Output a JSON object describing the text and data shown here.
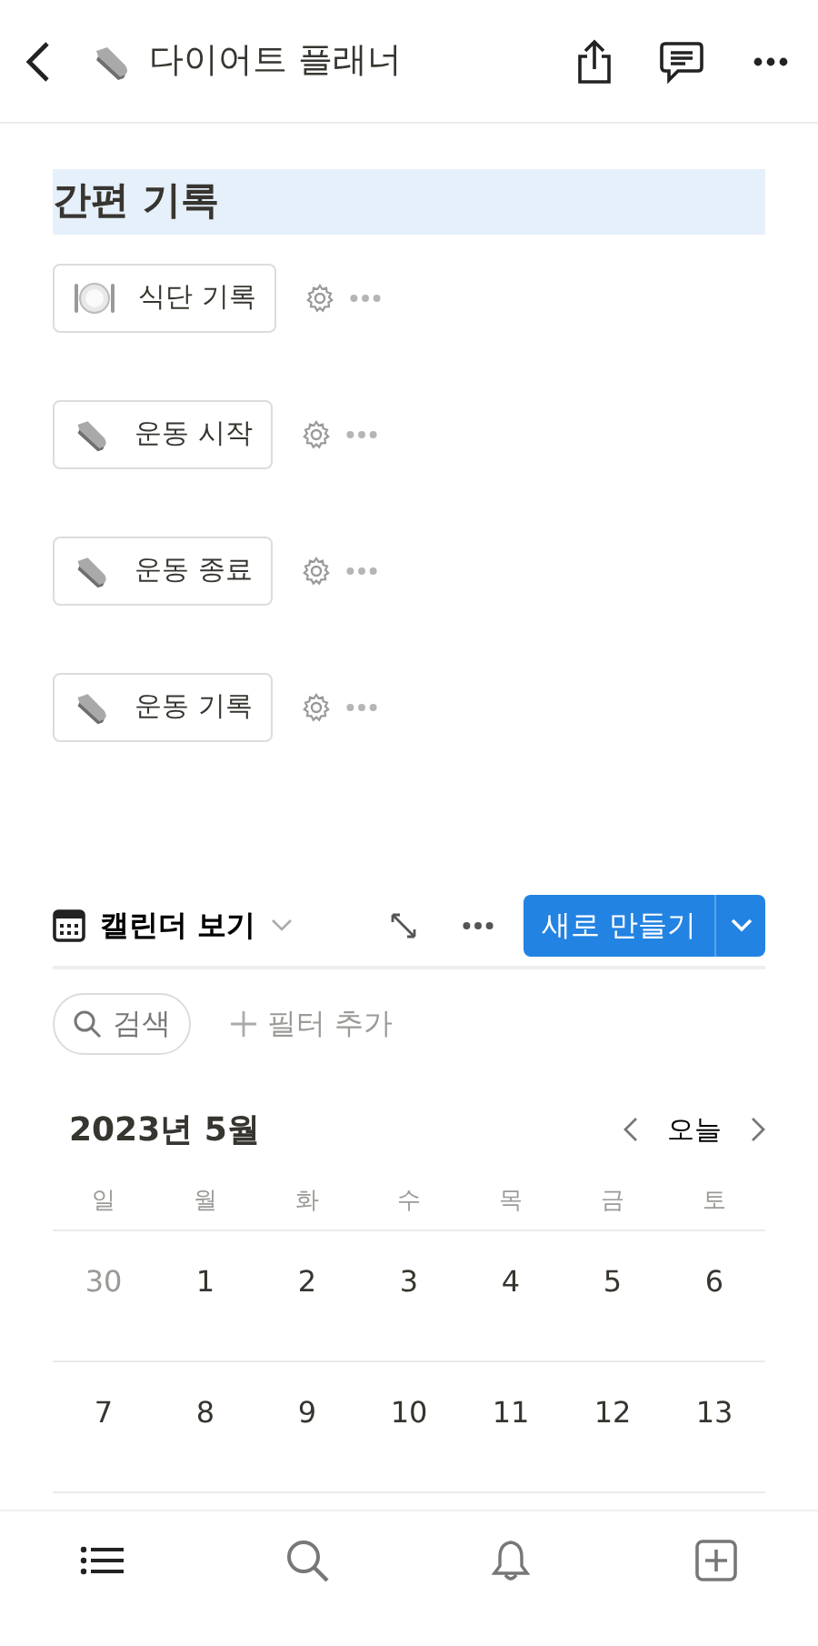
{
  "header": {
    "title": "다이어트 플래너"
  },
  "section": {
    "title": "간편 기록",
    "selected": true
  },
  "quick_buttons": [
    {
      "label": "식단 기록",
      "kind": "meal"
    },
    {
      "label": "운동 시작",
      "kind": "shoe"
    },
    {
      "label": "운동 종료",
      "kind": "shoe"
    },
    {
      "label": "운동 기록",
      "kind": "shoe"
    }
  ],
  "view": {
    "label": "캘린더 보기",
    "new_button": "새로 만들기"
  },
  "search": {
    "label": "검색"
  },
  "filter": {
    "label": "필터 추가"
  },
  "calendar": {
    "month": "2023년 5월",
    "today": "오늘",
    "weekdays": [
      "일",
      "월",
      "화",
      "수",
      "목",
      "금",
      "토"
    ],
    "weeks": [
      [
        {
          "day": "30",
          "muted": true
        },
        {
          "day": "1",
          "muted": false
        },
        {
          "day": "2",
          "muted": false
        },
        {
          "day": "3",
          "muted": false
        },
        {
          "day": "4",
          "muted": false
        },
        {
          "day": "5",
          "muted": false
        },
        {
          "day": "6",
          "muted": false
        }
      ],
      [
        {
          "day": "7",
          "muted": false
        },
        {
          "day": "8",
          "muted": false
        },
        {
          "day": "9",
          "muted": false
        },
        {
          "day": "10",
          "muted": false
        },
        {
          "day": "11",
          "muted": false
        },
        {
          "day": "12",
          "muted": false
        },
        {
          "day": "13",
          "muted": false
        }
      ]
    ]
  },
  "tab_bar": [
    {
      "kind": "list"
    },
    {
      "kind": "search"
    },
    {
      "kind": "bell"
    },
    {
      "kind": "add"
    }
  ]
}
